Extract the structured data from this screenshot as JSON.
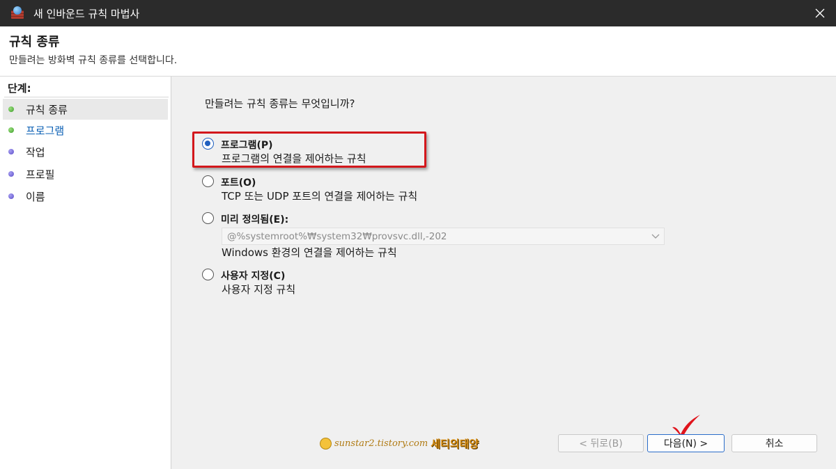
{
  "window": {
    "title": "새 인바운드 규칙 마법사"
  },
  "header": {
    "title": "규칙 종류",
    "subtitle": "만들려는 방화벽 규칙 종류를 선택합니다."
  },
  "sidebar": {
    "label": "단계:",
    "steps": [
      {
        "label": "규칙 종류",
        "status": "done"
      },
      {
        "label": "프로그램",
        "status": "done"
      },
      {
        "label": "작업",
        "status": "pending"
      },
      {
        "label": "프로필",
        "status": "pending"
      },
      {
        "label": "이름",
        "status": "pending"
      }
    ]
  },
  "main": {
    "question": "만들려는 규칙 종류는 무엇입니까?",
    "options": [
      {
        "title": "프로그램(P)",
        "desc": "프로그램의 연결을 제어하는 규칙",
        "selected": true
      },
      {
        "title": "포트(O)",
        "desc": "TCP 또는 UDP 포트의 연결을 제어하는 규칙",
        "selected": false
      },
      {
        "title": "미리 정의됨(E):",
        "desc": "Windows 환경의 연결을 제어하는 규칙",
        "selected": false
      },
      {
        "title": "사용자 지정(C)",
        "desc": "사용자 지정 규칙",
        "selected": false
      }
    ],
    "predefined_value": "@%systemroot%₩system32₩provsvc.dll,-202"
  },
  "buttons": {
    "back": "< 뒤로(B)",
    "next": "다음(N) >",
    "cancel": "취소"
  },
  "watermark": {
    "url": "sunstar2.tistory.com",
    "name": "세티의태양"
  },
  "colors": {
    "highlight": "#d3171c",
    "selected_radio": "#1f5fbf",
    "link": "#0a5fb4"
  }
}
